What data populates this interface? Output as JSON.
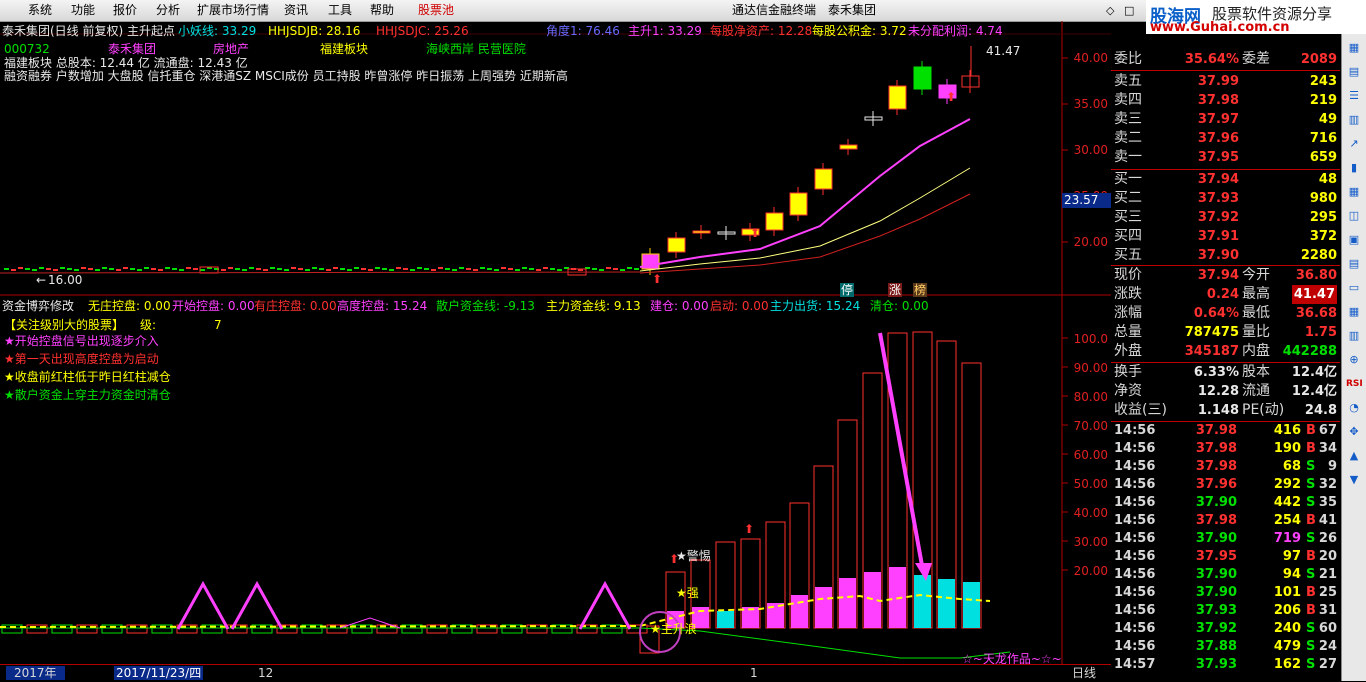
{
  "menu": {
    "items": [
      "系统",
      "功能",
      "报价",
      "分析",
      "扩展市场行情",
      "资讯",
      "工具",
      "帮助",
      "股票池"
    ],
    "app_title": "通达信金融终端",
    "stock_title": "泰禾集团",
    "window_buttons": [
      "◇",
      "□"
    ]
  },
  "brand": {
    "name": "股海网",
    "slogan": "股票软件资源分享",
    "url": "www.Guhai.com.cn"
  },
  "header": {
    "title": "泰禾集团(日线 前复权) 主升起点",
    "ind_xiaoyao": "小妖线: 33.29",
    "ind_hhjsdjb": "HHJSDJB: 28.16",
    "ind_hhjsdjc": "HHJSDJC: 25.26",
    "ind_jiaodu": "角度1: 76.46",
    "ind_zhusheng": "主升1: 33.29",
    "ind_jzc": "每股净资产: 12.28",
    "ind_gjj": "每股公积金: 3.72",
    "ind_wfp": "未分配利润: 4.74"
  },
  "info": {
    "code": "000732",
    "name": "泰禾集团",
    "industry": "房地产",
    "region": "福建板块",
    "concept": "海峡西岸 民营医院",
    "line2": "福建板块  总股本: 12.44 亿    流通盘: 12.43 亿",
    "line3": "融资融券 户数增加 大盘股 信托重仓 深港通SZ MSCI成份 员工持股 昨曾涨停 昨日振荡 上周强势 近期新高"
  },
  "price_axis": [
    "40.00",
    "35.00",
    "30.00",
    "25.00",
    "20.00"
  ],
  "price_marker": "23.57",
  "high_label": "41.47",
  "low_label": "16.00",
  "tags": {
    "t1": "停",
    "t2": "涨",
    "t3": "榜"
  },
  "sub": {
    "title": "资金博弈修改",
    "wzkp": "无庄控盘: 0.00",
    "kskp": "开始控盘: 0.00",
    "yzkp": "有庄控盘: 0.00",
    "gdkp": "高度控盘: 15.24",
    "shzj": "散户资金线: -9.13",
    "zlzj": "主力资金线: 9.13",
    "jc": "建仓: 0.00",
    "qd": "启动: 0.00",
    "zlch": "主力出货: 15.24",
    "qc": "清仓: 0.00",
    "note_title": "【关注级别大的股票】",
    "note_level_label": "级:",
    "note_level_value": "7",
    "legend1": "★开始控盘信号出现逐步介入",
    "legend2": "★第一天出现高度控盘为启动",
    "legend3": "★收盘前红柱低于昨日红柱减仓",
    "legend4": "★散户资金上穿主力资金时清仓",
    "mark_alert": "★警惕",
    "mark_strong": "★强",
    "mark_main": "★主升浪",
    "credit": "☆~天龙作品~☆~",
    "axis": [
      "100.0",
      "90.00",
      "80.00",
      "70.00",
      "60.00",
      "50.00",
      "40.00",
      "30.00",
      "20.00"
    ]
  },
  "dates": {
    "d1": "2017年",
    "d2": "2017/11/23/四",
    "d3": "12",
    "d4": "1",
    "period": "日线"
  },
  "quote": {
    "weibi_label": "委比",
    "weibi": "35.64%",
    "weicha_label": "委差",
    "weicha": "2089",
    "asks": [
      {
        "label": "卖五",
        "price": "37.99",
        "vol": "243"
      },
      {
        "label": "卖四",
        "price": "37.98",
        "vol": "219"
      },
      {
        "label": "卖三",
        "price": "37.97",
        "vol": "49"
      },
      {
        "label": "卖二",
        "price": "37.96",
        "vol": "716"
      },
      {
        "label": "卖一",
        "price": "37.95",
        "vol": "659"
      }
    ],
    "bids": [
      {
        "label": "买一",
        "price": "37.94",
        "vol": "48"
      },
      {
        "label": "买二",
        "price": "37.93",
        "vol": "980"
      },
      {
        "label": "买三",
        "price": "37.92",
        "vol": "295"
      },
      {
        "label": "买四",
        "price": "37.91",
        "vol": "372"
      },
      {
        "label": "买五",
        "price": "37.90",
        "vol": "2280"
      }
    ],
    "stats": [
      {
        "l1": "现价",
        "v1": "37.94",
        "l2": "今开",
        "v2": "36.80",
        "c1": "#ff3030",
        "c2": "#ff3030"
      },
      {
        "l1": "涨跌",
        "v1": "0.24",
        "l2": "最高",
        "v2": "41.47",
        "c1": "#ff3030",
        "c2": "#ff3030"
      },
      {
        "l1": "涨幅",
        "v1": "0.64%",
        "l2": "最低",
        "v2": "36.68",
        "c1": "#ff3030",
        "c2": "#ff3030"
      },
      {
        "l1": "总量",
        "v1": "787475",
        "l2": "量比",
        "v2": "1.75",
        "c1": "#ffff00",
        "c2": "#ff3030"
      },
      {
        "l1": "外盘",
        "v1": "345187",
        "l2": "内盘",
        "v2": "442288",
        "c1": "#ff3030",
        "c2": "#00e000"
      }
    ],
    "stats2": [
      {
        "l1": "换手",
        "v1": "6.33%",
        "l2": "股本",
        "v2": "12.4亿"
      },
      {
        "l1": "净资",
        "v1": "12.28",
        "l2": "流通",
        "v2": "12.4亿"
      },
      {
        "l1": "收益(三)",
        "v1": "1.148",
        "l2": "PE(动)",
        "v2": "24.8"
      }
    ],
    "ticks": [
      {
        "t": "14:56",
        "p": "37.98",
        "v": "416",
        "s": "B",
        "n": "67"
      },
      {
        "t": "14:56",
        "p": "37.98",
        "v": "190",
        "s": "B",
        "n": "34"
      },
      {
        "t": "14:56",
        "p": "37.98",
        "v": "68",
        "s": "S",
        "n": "9"
      },
      {
        "t": "14:56",
        "p": "37.96",
        "v": "292",
        "s": "S",
        "n": "32"
      },
      {
        "t": "14:56",
        "p": "37.90",
        "v": "442",
        "s": "S",
        "n": "35"
      },
      {
        "t": "14:56",
        "p": "37.98",
        "v": "254",
        "s": "B",
        "n": "41"
      },
      {
        "t": "14:56",
        "p": "37.90",
        "v": "719",
        "s": "S",
        "n": "26"
      },
      {
        "t": "14:56",
        "p": "37.95",
        "v": "97",
        "s": "B",
        "n": "20"
      },
      {
        "t": "14:56",
        "p": "37.90",
        "v": "94",
        "s": "S",
        "n": "21"
      },
      {
        "t": "14:56",
        "p": "37.90",
        "v": "101",
        "s": "B",
        "n": "25"
      },
      {
        "t": "14:56",
        "p": "37.93",
        "v": "206",
        "s": "B",
        "n": "31"
      },
      {
        "t": "14:56",
        "p": "37.92",
        "v": "240",
        "s": "S",
        "n": "60"
      },
      {
        "t": "14:56",
        "p": "37.88",
        "v": "479",
        "s": "S",
        "n": "24"
      },
      {
        "t": "14:57",
        "p": "37.93",
        "v": "162",
        "s": "S",
        "n": "27"
      }
    ]
  },
  "colors": {
    "up": "#ff3030",
    "down": "#00e000",
    "accent": "#ffff00",
    "magenta": "#ff40ff",
    "cyan": "#00e0e0",
    "grid": "#b00000"
  }
}
